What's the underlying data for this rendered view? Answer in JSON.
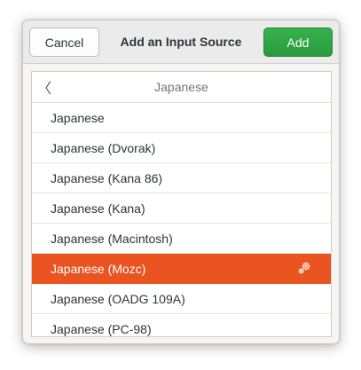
{
  "dialog": {
    "title": "Add an Input Source",
    "cancel_label": "Cancel",
    "add_label": "Add"
  },
  "list": {
    "header": "Japanese",
    "back_glyph": "〈",
    "items": [
      {
        "label": "Japanese"
      },
      {
        "label": "Japanese (Dvorak)"
      },
      {
        "label": "Japanese (Kana 86)"
      },
      {
        "label": "Japanese (Kana)"
      },
      {
        "label": "Japanese (Macintosh)"
      },
      {
        "label": "Japanese (Mozc)",
        "selected": true,
        "icon": "gear-icon"
      },
      {
        "label": "Japanese (OADG 109A)"
      },
      {
        "label": "Japanese (PC-98)"
      }
    ]
  },
  "colors": {
    "accent": "#e95420",
    "add_button": "#2ea043"
  }
}
